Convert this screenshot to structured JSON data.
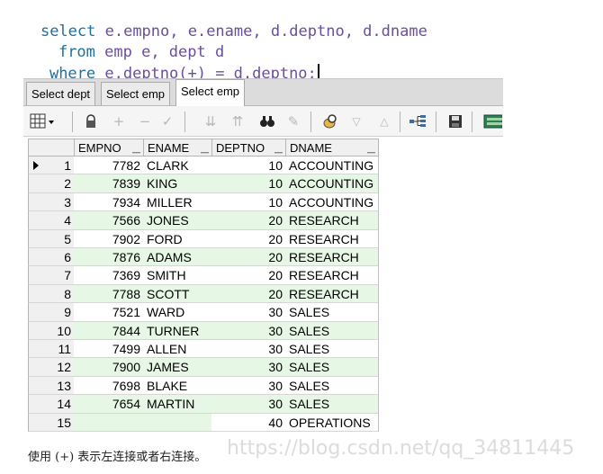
{
  "sql": {
    "line1": {
      "kw": "select",
      "rest": " e.empno, e.ename, d.deptno, d.dname"
    },
    "line2": {
      "kw": "from",
      "rest": " emp e, dept d"
    },
    "line3": {
      "kw": "where",
      "rest": " e.deptno(+) = d.deptno;"
    }
  },
  "tabs": [
    "Select dept",
    "Select emp",
    "Select emp"
  ],
  "active_tab_index": 2,
  "grid": {
    "columns": [
      "EMPNO",
      "ENAME",
      "DEPTNO",
      "DNAME"
    ],
    "current_row": 1,
    "rows": [
      {
        "n": "1",
        "empno": "7782",
        "ename": "CLARK",
        "deptno": "10",
        "dname": "ACCOUNTING"
      },
      {
        "n": "2",
        "empno": "7839",
        "ename": "KING",
        "deptno": "10",
        "dname": "ACCOUNTING"
      },
      {
        "n": "3",
        "empno": "7934",
        "ename": "MILLER",
        "deptno": "10",
        "dname": "ACCOUNTING"
      },
      {
        "n": "4",
        "empno": "7566",
        "ename": "JONES",
        "deptno": "20",
        "dname": "RESEARCH"
      },
      {
        "n": "5",
        "empno": "7902",
        "ename": "FORD",
        "deptno": "20",
        "dname": "RESEARCH"
      },
      {
        "n": "6",
        "empno": "7876",
        "ename": "ADAMS",
        "deptno": "20",
        "dname": "RESEARCH"
      },
      {
        "n": "7",
        "empno": "7369",
        "ename": "SMITH",
        "deptno": "20",
        "dname": "RESEARCH"
      },
      {
        "n": "8",
        "empno": "7788",
        "ename": "SCOTT",
        "deptno": "20",
        "dname": "RESEARCH"
      },
      {
        "n": "9",
        "empno": "7521",
        "ename": "WARD",
        "deptno": "30",
        "dname": "SALES"
      },
      {
        "n": "10",
        "empno": "7844",
        "ename": "TURNER",
        "deptno": "30",
        "dname": "SALES"
      },
      {
        "n": "11",
        "empno": "7499",
        "ename": "ALLEN",
        "deptno": "30",
        "dname": "SALES"
      },
      {
        "n": "12",
        "empno": "7900",
        "ename": "JAMES",
        "deptno": "30",
        "dname": "SALES"
      },
      {
        "n": "13",
        "empno": "7698",
        "ename": "BLAKE",
        "deptno": "30",
        "dname": "SALES"
      },
      {
        "n": "14",
        "empno": "7654",
        "ename": "MARTIN",
        "deptno": "30",
        "dname": "SALES"
      },
      {
        "n": "15",
        "empno": "",
        "ename": "",
        "deptno": "40",
        "dname": "OPERATIONS"
      }
    ]
  },
  "toolbar": {
    "icons": [
      "grid-view-icon",
      "lock-icon",
      "add-record-icon",
      "delete-record-icon",
      "post-changes-icon",
      "filter-down-icon",
      "filter-up-icon",
      "find-icon",
      "clear-icon",
      "query-icon",
      "next-icon",
      "prev-icon",
      "tree-icon",
      "save-icon",
      "export-icon"
    ]
  },
  "caption": "使用 (+) 表示左连接或者右连接。",
  "watermark": "https://blog.csdn.net/qq_34811445",
  "colors": {
    "keyword": "#1f6f9f",
    "identifier": "#6a4e9e",
    "row_green": "#e6f7e6",
    "tab_bar": "#dcdcdc"
  }
}
